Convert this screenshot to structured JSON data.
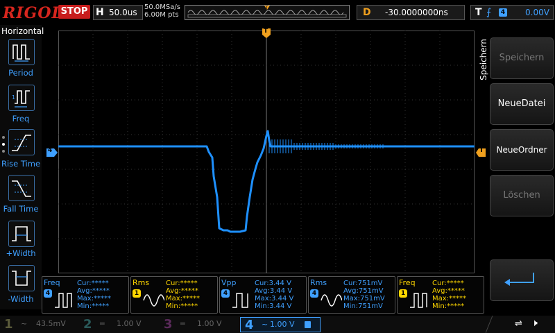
{
  "header": {
    "logo": "RIGOL",
    "run_status": "STOP",
    "timebase_label": "H",
    "timebase_value": "50.0us",
    "sample_rate": "50.0MSa/s",
    "memory_depth": "6.00M pts",
    "delay_label": "D",
    "delay_value": "-30.0000000ns",
    "trigger_label": "T",
    "trigger_source": "4",
    "trigger_level": "0.00V"
  },
  "left_menu": {
    "title": "Horizontal",
    "items": [
      {
        "label": "Period",
        "icon": "period-pulse-icon"
      },
      {
        "label": "Freq",
        "icon": "freq-pulse-icon"
      },
      {
        "label": "Rise Time",
        "icon": "rise-edge-icon"
      },
      {
        "label": "Fall Time",
        "icon": "fall-edge-icon"
      },
      {
        "label": "+Width",
        "icon": "positive-width-icon"
      },
      {
        "label": "-Width",
        "icon": "negative-width-icon"
      }
    ]
  },
  "right_menu": {
    "title": "Speichern",
    "buttons": [
      {
        "label": "Speichern",
        "enabled": false
      },
      {
        "label": "NeueDatei",
        "enabled": true
      },
      {
        "label": "NeueOrdner",
        "enabled": true
      },
      {
        "label": "Löschen",
        "enabled": false
      }
    ],
    "return_icon": "return-arrow-icon"
  },
  "waveform": {
    "channel_marker": "4",
    "trigger_marker": "T",
    "color": "#1e90ff"
  },
  "measurements": [
    {
      "name": "Freq",
      "channel": "4",
      "channel_color": "#3fa0ff",
      "icon": "freq-icon",
      "lines": [
        "Cur:*****",
        "Avg:*****",
        "Max:*****",
        "Min:*****"
      ]
    },
    {
      "name": "Rms",
      "channel": "1",
      "channel_color": "#ffd700",
      "icon": "rms-sine-icon",
      "lines": [
        "Cur:*****",
        "Avg:*****",
        "Max:*****",
        "Min:*****"
      ]
    },
    {
      "name": "Vpp",
      "channel": "4",
      "channel_color": "#3fa0ff",
      "icon": "vpp-icon",
      "lines": [
        "Cur:3.44 V",
        "Avg:3.44 V",
        "Max:3.44 V",
        "Min:3.44 V"
      ]
    },
    {
      "name": "Rms",
      "channel": "4",
      "channel_color": "#3fa0ff",
      "icon": "rms-sine-icon",
      "lines": [
        "Cur:751mV",
        "Avg:751mV",
        "Max:751mV",
        "Min:751mV"
      ]
    },
    {
      "name": "Freq",
      "channel": "1",
      "channel_color": "#ffd700",
      "icon": "freq-icon",
      "lines": [
        "Cur:*****",
        "Avg:*****",
        "Max:*****",
        "Min:*****"
      ]
    }
  ],
  "channels": [
    {
      "number": "1",
      "value": "43.5mV",
      "active": false
    },
    {
      "number": "2",
      "value": "1.00 V",
      "active": false
    },
    {
      "number": "3",
      "value": "1.00 V",
      "active": false
    },
    {
      "number": "4",
      "value": "1.00 V",
      "active": true
    }
  ],
  "colors": {
    "accent": "#1e90ff",
    "stop": "#c81d1d",
    "trigger": "#f0a01e",
    "ch1": "#ffd700",
    "ch4": "#3fa0ff"
  }
}
